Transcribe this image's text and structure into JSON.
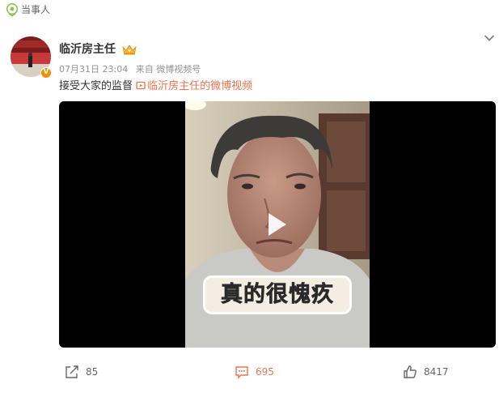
{
  "header": {
    "party_label": "当事人",
    "party_icon": "location-pin-icon"
  },
  "post": {
    "username": "临沂房主任",
    "verified_badge": "V",
    "date": "07月31日 23:04",
    "source": "来自 微博视频号",
    "text": "接受大家的监督",
    "video_link": "临沂房主任的微博视频"
  },
  "video": {
    "caption": "真的很愧疚"
  },
  "actions": {
    "repost_count": "85",
    "comment_count": "695",
    "like_count": "8417"
  },
  "colors": {
    "accent": "#eb7350",
    "party_icon": "#8bc34a",
    "badge": "#f39100"
  }
}
